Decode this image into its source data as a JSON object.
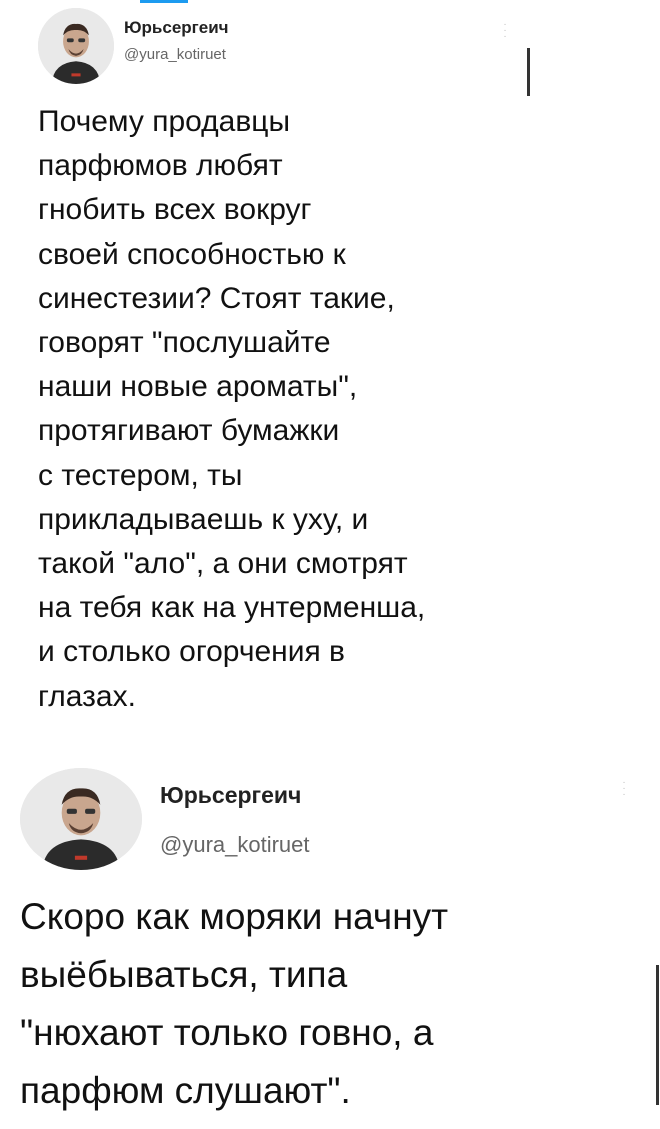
{
  "theme": {
    "accent": "#1d9bf0",
    "text": "#111111",
    "muted": "#666666"
  },
  "tweets": [
    {
      "name": "Юрьсергеич",
      "handle": "@yura_kotiruet",
      "more_icon": "more-vertical-icon",
      "text": "Почему продавцы\nпарфюмов любят\nгнобить всех вокруг\nсвоей способностью к\nсинестезии? Стоят такие,\nговорят \"послушайте\nнаши новые ароматы\",\nпротягивают бумажки\nс тестером, ты\nприкладываешь к уху, и\nтакой \"ало\", а они смотрят\nна тебя как на унтерменша,\nи столько огорчения в\nглазах."
    },
    {
      "name": "Юрьсергеич",
      "handle": "@yura_kotiruet",
      "more_icon": "more-vertical-icon",
      "text": "Скоро как моряки начнут\nвыёбываться, типа\n\"нюхают только говно, а\nпарфюм слушают\"."
    }
  ]
}
